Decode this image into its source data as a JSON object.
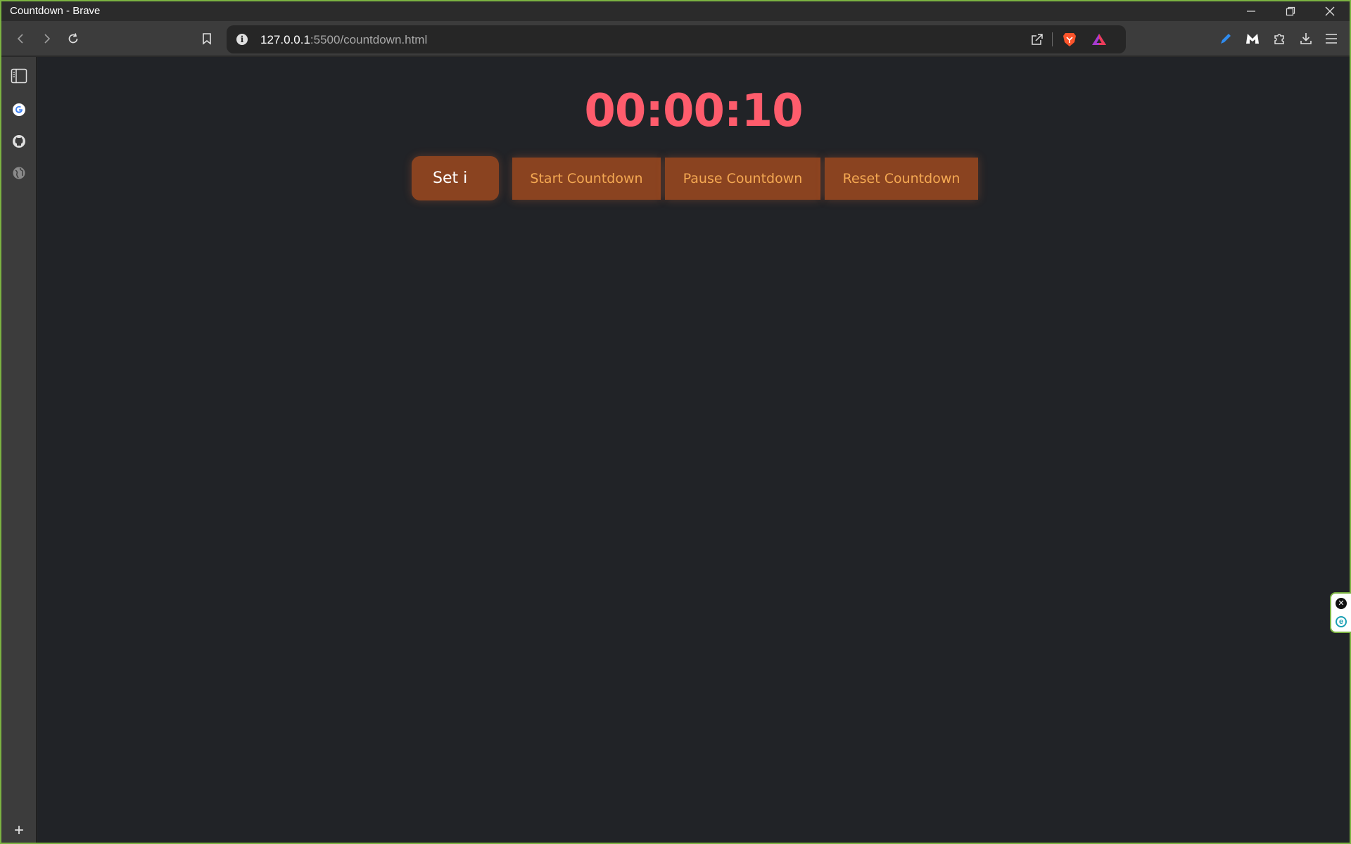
{
  "window": {
    "title": "Countdown - Brave",
    "minimize_icon": "minimize-icon",
    "restore_icon": "restore-icon",
    "close_icon": "close-icon"
  },
  "toolbar": {
    "url_host": "127.0.0.1",
    "url_path": ":5500/countdown.html"
  },
  "page": {
    "timer": "00:00:10",
    "buttons": {
      "set": "Set i",
      "start": "Start Countdown",
      "pause": "Pause Countdown",
      "reset": "Reset Countdown"
    }
  },
  "sidebar": {
    "add_label": "+"
  },
  "colors": {
    "page_bg": "#212327",
    "timer": "#ff5c6c",
    "button_bg": "#8a4320",
    "button_text": "#f4a852",
    "window_border": "#7cb342"
  }
}
